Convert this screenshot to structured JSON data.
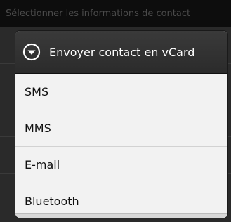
{
  "background": {
    "header_text": "Sélectionner les informations de contact"
  },
  "dialog": {
    "title": "Envoyer contact en vCard",
    "icon": "chevron-down-circle-icon",
    "items": [
      {
        "label": "SMS"
      },
      {
        "label": "MMS"
      },
      {
        "label": "E-mail"
      },
      {
        "label": "Bluetooth"
      }
    ]
  },
  "colors": {
    "title_bar": "#2f2f2f",
    "list_bg": "#f2f2f2",
    "divider": "#d2d2d2",
    "text_dark": "#111111",
    "text_light": "#ffffff"
  }
}
